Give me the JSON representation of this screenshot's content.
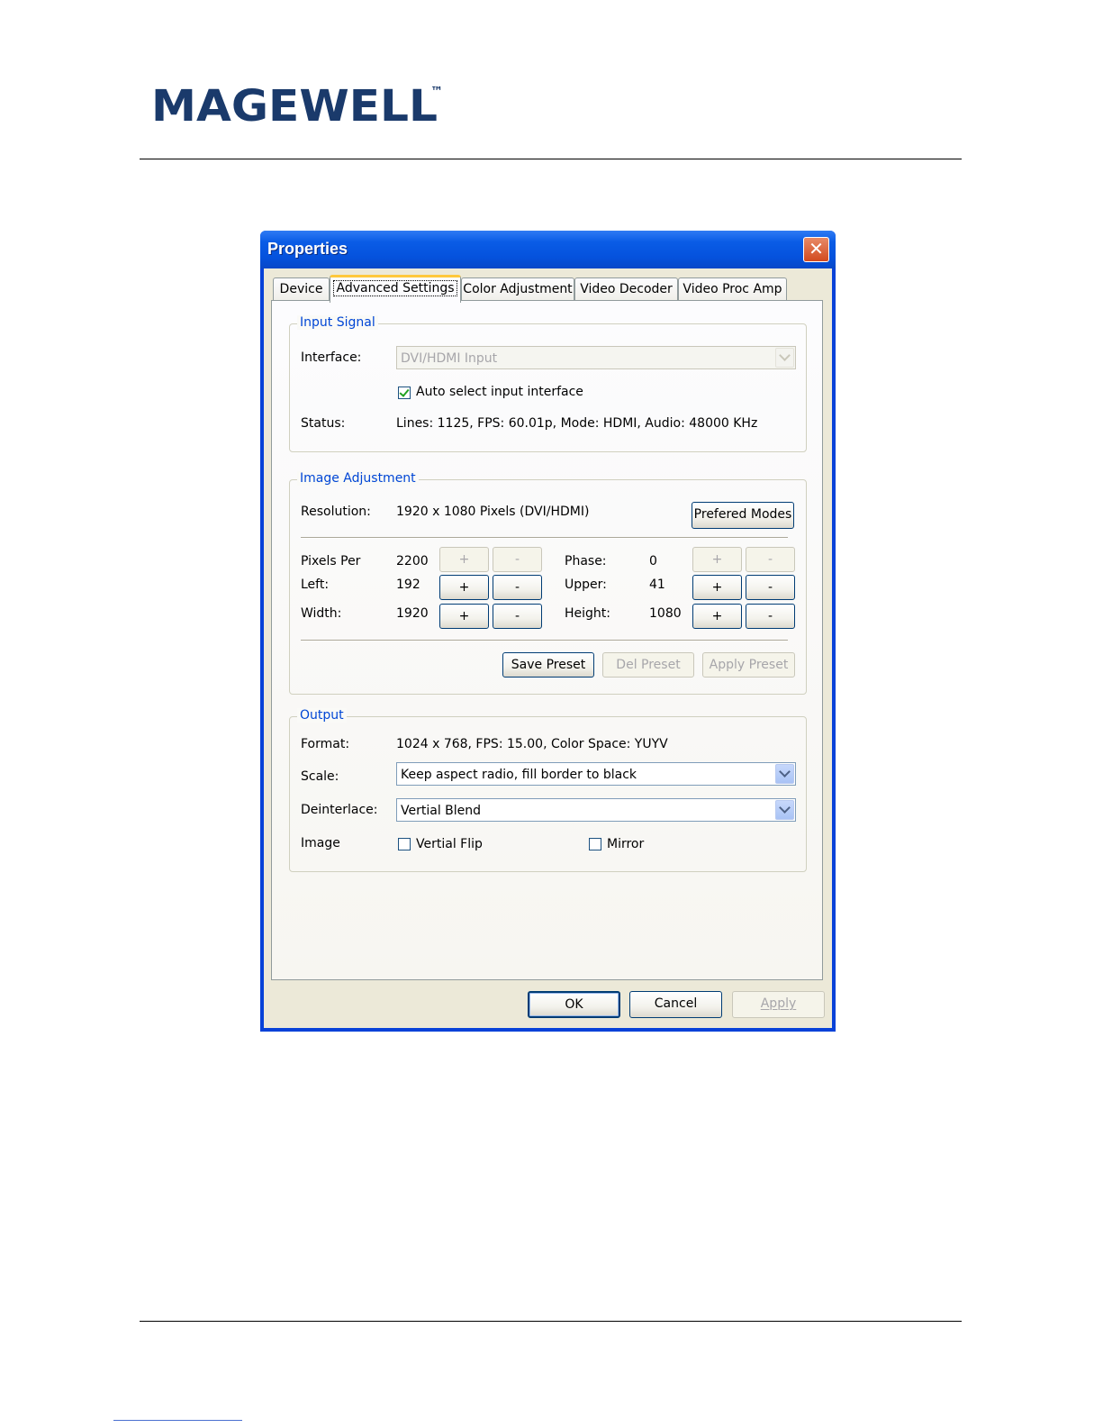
{
  "page": {
    "logo_text": "MAGEWELL",
    "trademark": "™"
  },
  "window": {
    "title": "Properties",
    "close_glyph": "✕"
  },
  "tabs": [
    {
      "label": "Device"
    },
    {
      "label": "Advanced Settings"
    },
    {
      "label": "Color Adjustment"
    },
    {
      "label": "Video Decoder"
    },
    {
      "label": "Video Proc Amp"
    }
  ],
  "input_signal": {
    "legend": "Input Signal",
    "interface_label": "Interface:",
    "interface_value": "DVI/HDMI Input",
    "auto_select_label": "Auto select input interface",
    "status_label": "Status:",
    "status_value": "Lines: 1125, FPS: 60.01p, Mode: HDMI, Audio: 48000 KHz"
  },
  "image_adjustment": {
    "legend": "Image Adjustment",
    "resolution_label": "Resolution:",
    "resolution_value": "1920 x 1080 Pixels (DVI/HDMI)",
    "prefered_modes_label": "Prefered Modes",
    "plus": "+",
    "minus": "-",
    "pixels_per_label": "Pixels Per",
    "pixels_per_value": "2200",
    "left_label": "Left:",
    "left_value": "192",
    "width_label": "Width:",
    "width_value": "1920",
    "phase_label": "Phase:",
    "phase_value": "0",
    "upper_label": "Upper:",
    "upper_value": "41",
    "height_label": "Height:",
    "height_value": "1080",
    "save_preset_label": "Save Preset",
    "del_preset_label": "Del Preset",
    "apply_preset_label": "Apply Preset"
  },
  "output": {
    "legend": "Output",
    "format_label": "Format:",
    "format_value": "1024 x 768, FPS: 15.00, Color Space: YUYV",
    "scale_label": "Scale:",
    "scale_value": "Keep aspect radio, fill border to black",
    "deinterlace_label": "Deinterlace:",
    "deinterlace_value": "Vertial Blend",
    "image_label": "Image",
    "vertial_flip_label": "Vertial Flip",
    "mirror_label": "Mirror"
  },
  "footer_buttons": {
    "ok_label": "OK",
    "cancel_label": "Cancel",
    "apply_label": "Apply"
  },
  "colors": {
    "title_blue": "#0552dd",
    "group_legend": "#0046d5",
    "logo_blue": "#1a3a6b",
    "dialog_face": "#ece9d8"
  }
}
